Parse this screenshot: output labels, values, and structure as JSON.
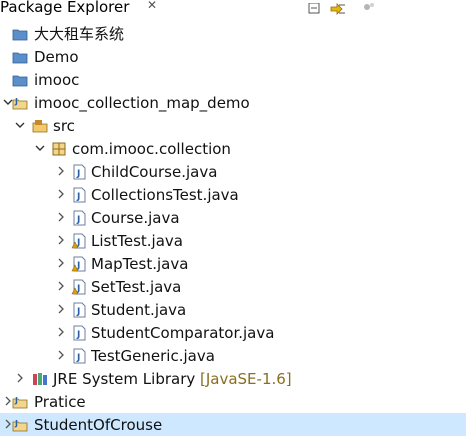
{
  "view": {
    "title": "Package Explorer",
    "close_glyph": "✕"
  },
  "toolbar": {
    "icons": [
      "collapse-all-icon",
      "link-with-editor-icon",
      "view-menu-icon"
    ]
  },
  "tree": {
    "items": [
      {
        "label": "大大租车系统",
        "icon": "project-folder-icon",
        "expanded": null,
        "level": 0
      },
      {
        "label": "Demo",
        "icon": "project-folder-icon",
        "expanded": null,
        "level": 0
      },
      {
        "label": "imooc",
        "icon": "project-folder-icon",
        "expanded": null,
        "level": 0
      },
      {
        "label": "imooc_collection_map_demo",
        "icon": "java-project-icon",
        "expanded": true,
        "level": 0
      },
      {
        "label": "src",
        "icon": "source-folder-icon",
        "expanded": true,
        "level": 1
      },
      {
        "label": "com.imooc.collection",
        "icon": "package-icon",
        "expanded": true,
        "level": 2
      },
      {
        "label": "ChildCourse.java",
        "icon": "java-file-icon",
        "expanded": false,
        "level": 3
      },
      {
        "label": "CollectionsTest.java",
        "icon": "java-file-icon",
        "expanded": false,
        "level": 3
      },
      {
        "label": "Course.java",
        "icon": "java-file-icon",
        "expanded": false,
        "level": 3
      },
      {
        "label": "ListTest.java",
        "icon": "java-file-warning-icon",
        "expanded": false,
        "level": 3
      },
      {
        "label": "MapTest.java",
        "icon": "java-file-warning-icon",
        "expanded": false,
        "level": 3
      },
      {
        "label": "SetTest.java",
        "icon": "java-file-warning-icon",
        "expanded": false,
        "level": 3
      },
      {
        "label": "Student.java",
        "icon": "java-file-icon",
        "expanded": false,
        "level": 3
      },
      {
        "label": "StudentComparator.java",
        "icon": "java-file-icon",
        "expanded": false,
        "level": 3
      },
      {
        "label": "TestGeneric.java",
        "icon": "java-file-icon",
        "expanded": false,
        "level": 3
      },
      {
        "label": "JRE System Library",
        "decoration": "[JavaSE-1.6]",
        "icon": "library-icon",
        "expanded": false,
        "level": 1
      },
      {
        "label": "Pratice",
        "icon": "java-project-icon",
        "expanded": false,
        "level": 0
      },
      {
        "label": "StudentOfCrouse",
        "icon": "java-project-icon",
        "expanded": false,
        "level": 0,
        "selected": true
      }
    ]
  },
  "colors": {
    "selection": "#cde8ff",
    "decoration": "#8a6d1f",
    "folder": "#5b8fc9",
    "java": "#2b5fa8",
    "warning": "#e0a000"
  }
}
